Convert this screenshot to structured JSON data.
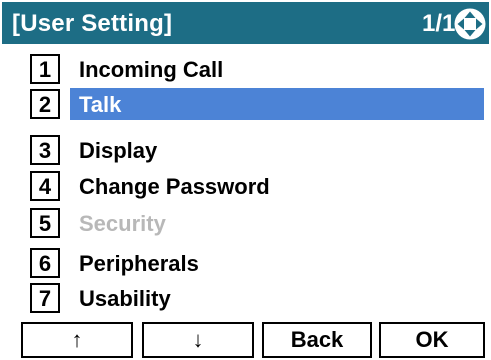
{
  "header": {
    "title": "[User Setting]",
    "page_indicator": "1/1",
    "nav_icon": "four-way-arrow-icon",
    "background_color": "#1d6d85"
  },
  "menu": {
    "selected_index": 1,
    "highlight_color": "#4c83d6",
    "disabled_color": "#b8b8b8",
    "items": [
      {
        "number": "1",
        "label": "Incoming Call",
        "state": "normal"
      },
      {
        "number": "2",
        "label": "Talk",
        "state": "selected"
      },
      {
        "number": "3",
        "label": "Display",
        "state": "normal"
      },
      {
        "number": "4",
        "label": "Change Password",
        "state": "normal"
      },
      {
        "number": "5",
        "label": "Security",
        "state": "disabled"
      },
      {
        "number": "6",
        "label": "Peripherals",
        "state": "normal"
      },
      {
        "number": "7",
        "label": "Usability",
        "state": "normal"
      }
    ]
  },
  "softkeys": {
    "up": "↑",
    "down": "↓",
    "back": "Back",
    "ok": "OK"
  }
}
